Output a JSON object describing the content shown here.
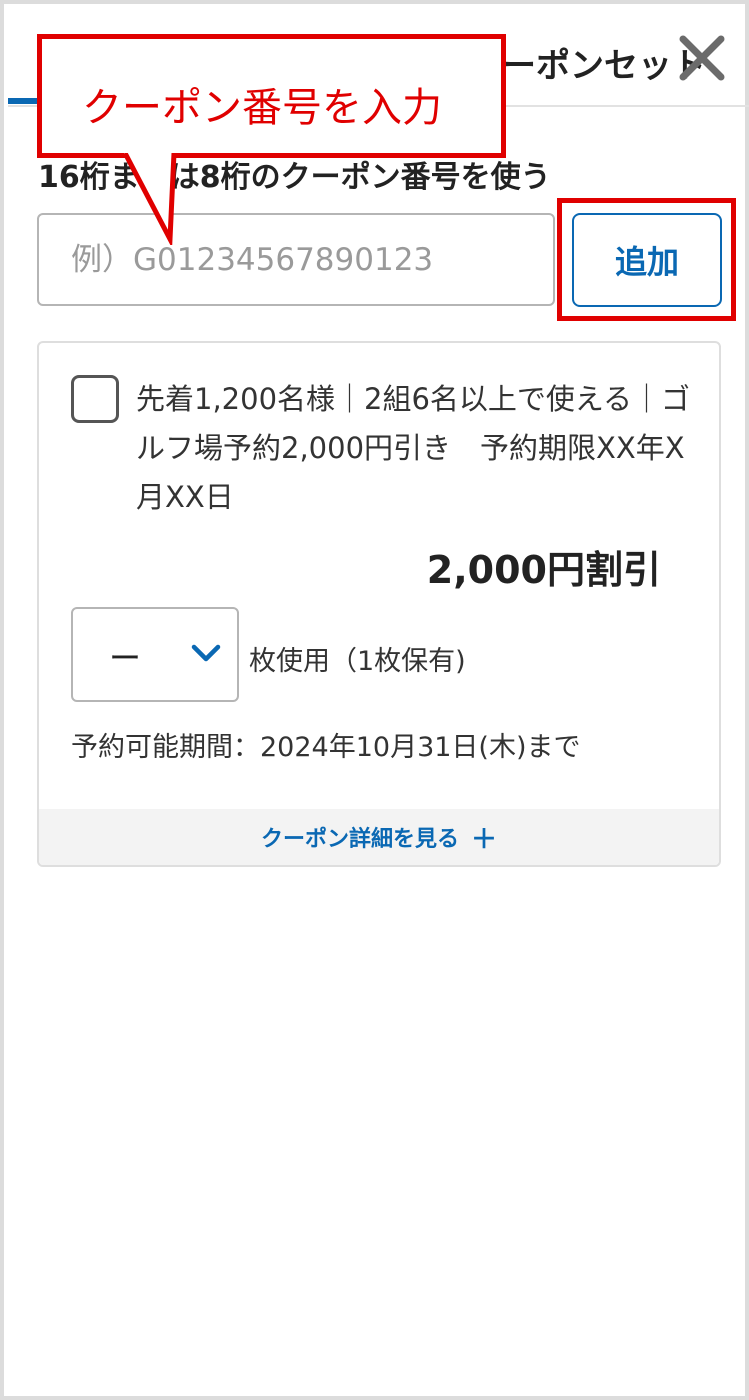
{
  "header": {
    "tab_title": "クーポンセット",
    "close_icon": "close-icon"
  },
  "coupon_code": {
    "label": "16桁または8桁のクーポン番号を使う",
    "placeholder": "例）G01234567890123",
    "value": "",
    "add_button_label": "追加"
  },
  "annotation": {
    "callout_text": "クーポン番号を入力",
    "highlight_color": "#e00000"
  },
  "coupon": {
    "checked": false,
    "description": "先着1,200名様｜2組6名以上で使える｜ゴルフ場予約2,000円引き　予約期限XX年X月XX日",
    "discount": "2,000円割引",
    "quantity": "ー",
    "quantity_label": "枚使用（1枚保有)",
    "period": "予約可能期間：2024年10月31日(木)まで",
    "details_link": "クーポン詳細を見る",
    "details_icon": "plus-icon"
  },
  "colors": {
    "accent": "#0a68b3",
    "text": "#222222",
    "border": "#b5b5b5"
  }
}
